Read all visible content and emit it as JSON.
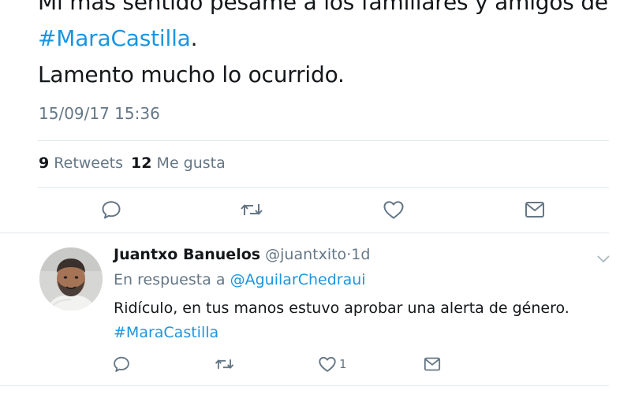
{
  "tweet": {
    "line1": "Mi más sentido pésame a los familiares y amigos de",
    "hashtag": "#MaraCastilla",
    "hashtag_suffix": ".",
    "line3": "Lamento mucho lo ocurrido.",
    "timestamp": "15/09/17 15:36",
    "retweets_count": "9",
    "retweets_label": "Retweets",
    "likes_count": "12",
    "likes_label": "Me gusta"
  },
  "reply": {
    "name": "Juantxo Banuelos",
    "handle": "@juantxito",
    "separator": "·",
    "time": "1d",
    "reply_to_label": "En respuesta a",
    "reply_to_mention": "@AguilarChedraui",
    "body_text": "Ridículo, en tus manos estuvo aprobar una alerta de género.",
    "body_hashtag": "#MaraCastilla",
    "like_count": "1"
  },
  "icons": {
    "reply": "speech-bubble-icon",
    "retweet": "retweet-icon",
    "like": "heart-icon",
    "message": "envelope-icon",
    "caret": "chevron-down-icon"
  },
  "colors": {
    "link": "#1b95e0",
    "text": "#14171a",
    "secondary": "#657786",
    "divider": "#e1e8ed"
  }
}
